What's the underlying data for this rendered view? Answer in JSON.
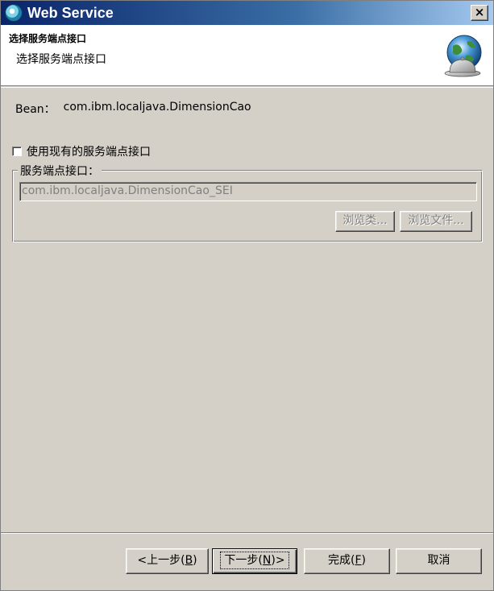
{
  "window": {
    "title": "Web Service",
    "close_glyph": "×"
  },
  "banner": {
    "title": "选择服务端点接口",
    "description": "选择服务端点接口",
    "icon": "globe-bell-icon"
  },
  "content": {
    "bean_label": "Bean：",
    "bean_value": "com.ibm.localjava.DimensionCao",
    "use_existing_checkbox": {
      "label": "使用现有的服务端点接口",
      "checked": false
    },
    "group": {
      "legend": "服务端点接口：",
      "sei_value": "com.ibm.localjava.DimensionCao_SEI",
      "browse_class_label": "浏览类...",
      "browse_file_label": "浏览文件..."
    }
  },
  "footer": {
    "back": {
      "prefix": "<上一步(",
      "mnemonic": "B",
      "suffix": ")"
    },
    "next": {
      "prefix": "下一步(",
      "mnemonic": "N",
      "suffix": ")>"
    },
    "finish": {
      "prefix": "完成(",
      "mnemonic": "F",
      "suffix": ")"
    },
    "cancel": "取消"
  },
  "colors": {
    "title_bar_start": "#0a246a",
    "title_bar_end": "#a6caf0",
    "dialog_bg": "#d4d0c8",
    "disabled_text": "#808080"
  }
}
